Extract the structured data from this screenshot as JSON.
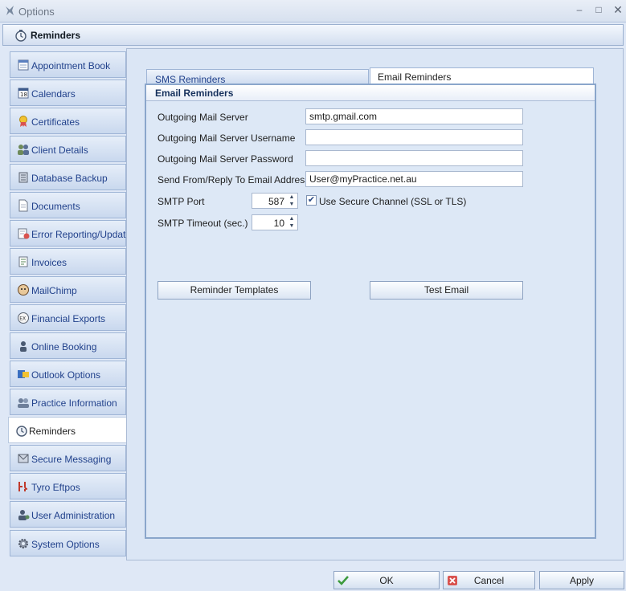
{
  "window": {
    "title": "Options",
    "minimize_glyph": "–",
    "maximize_glyph": "□",
    "close_glyph": "✕"
  },
  "header": {
    "title": "Reminders"
  },
  "sidebar": {
    "items": [
      {
        "label": "Appointment Book",
        "icon": "appointment-book-icon"
      },
      {
        "label": "Calendars",
        "icon": "calendar-icon"
      },
      {
        "label": "Certificates",
        "icon": "certificate-icon"
      },
      {
        "label": "Client Details",
        "icon": "clients-icon"
      },
      {
        "label": "Database Backup",
        "icon": "database-backup-icon"
      },
      {
        "label": "Documents",
        "icon": "document-icon"
      },
      {
        "label": "Error Reporting/Updates",
        "icon": "error-reporting-icon"
      },
      {
        "label": "Invoices",
        "icon": "invoice-icon"
      },
      {
        "label": "MailChimp",
        "icon": "mailchimp-icon"
      },
      {
        "label": "Financial Exports",
        "icon": "export-icon"
      },
      {
        "label": "Online Booking",
        "icon": "online-booking-icon"
      },
      {
        "label": "Outlook Options",
        "icon": "outlook-icon"
      },
      {
        "label": "Practice Information",
        "icon": "practice-info-icon"
      },
      {
        "label": "Reminders",
        "icon": "reminder-clock-icon",
        "active": true
      },
      {
        "label": "Secure Messaging",
        "icon": "secure-messaging-icon"
      },
      {
        "label": "Tyro Eftpos",
        "icon": "tyro-icon"
      },
      {
        "label": "User Administration",
        "icon": "user-admin-icon"
      },
      {
        "label": "System Options",
        "icon": "gear-icon"
      }
    ]
  },
  "tabs": {
    "sms": "SMS Reminders",
    "email": "Email Reminders",
    "active": "email"
  },
  "email_reminders": {
    "group_title": "Email Reminders",
    "outgoing_server_label": "Outgoing Mail Server",
    "outgoing_server_value": "smtp.gmail.com",
    "username_label": "Outgoing Mail Server Username",
    "username_value": "",
    "password_label": "Outgoing Mail Server Password",
    "password_value": "",
    "send_from_label": "Send From/Reply To Email Address",
    "send_from_value": "User@myPractice.net.au",
    "smtp_port_label": "SMTP Port",
    "smtp_port_value": "587",
    "secure_channel_label": "Use Secure Channel (SSL or TLS)",
    "secure_channel_checked": true,
    "smtp_timeout_label": "SMTP Timeout (sec.)",
    "smtp_timeout_value": "10",
    "reminder_templates_label": "Reminder Templates",
    "test_email_label": "Test Email",
    "spin_up_glyph": "▲",
    "spin_down_glyph": "▼",
    "check_glyph": "✔"
  },
  "footer": {
    "ok_label": "OK",
    "cancel_label": "Cancel",
    "apply_label": "Apply"
  }
}
